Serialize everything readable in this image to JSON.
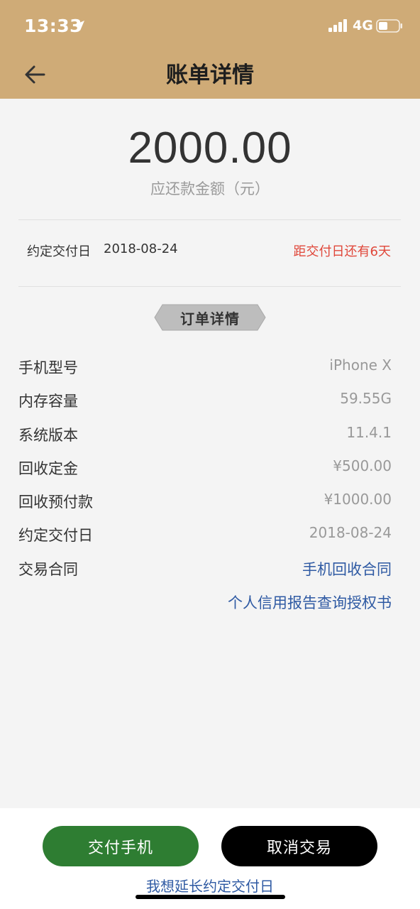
{
  "status_bar": {
    "time": "13:33",
    "network": "4G"
  },
  "nav": {
    "title": "账单详情"
  },
  "bill": {
    "amount": "2000.00",
    "amount_label": "应还款金额（元）",
    "due_label": "约定交付日",
    "due_date": "2018-08-24",
    "countdown": "距交付日还有6天"
  },
  "section_title": "订单详情",
  "details": [
    {
      "label": "手机型号",
      "value": "iPhone X"
    },
    {
      "label": "内存容量",
      "value": "59.55G"
    },
    {
      "label": "系统版本",
      "value": "11.4.1"
    },
    {
      "label": "回收定金",
      "value": "¥500.00"
    },
    {
      "label": "回收预付款",
      "value": "¥1000.00"
    },
    {
      "label": "约定交付日",
      "value": "2018-08-24"
    }
  ],
  "contract": {
    "label": "交易合同",
    "links": [
      "手机回收合同",
      "个人信用报告查询授权书"
    ]
  },
  "footer": {
    "deliver_button": "交付手机",
    "cancel_button": "取消交易",
    "extend_link": "我想延长约定交付日"
  },
  "colors": {
    "header_bg": "#cfab77",
    "countdown_red": "#e0473a",
    "link_blue": "#2f5aa3",
    "deliver_green": "#2e7d32"
  }
}
